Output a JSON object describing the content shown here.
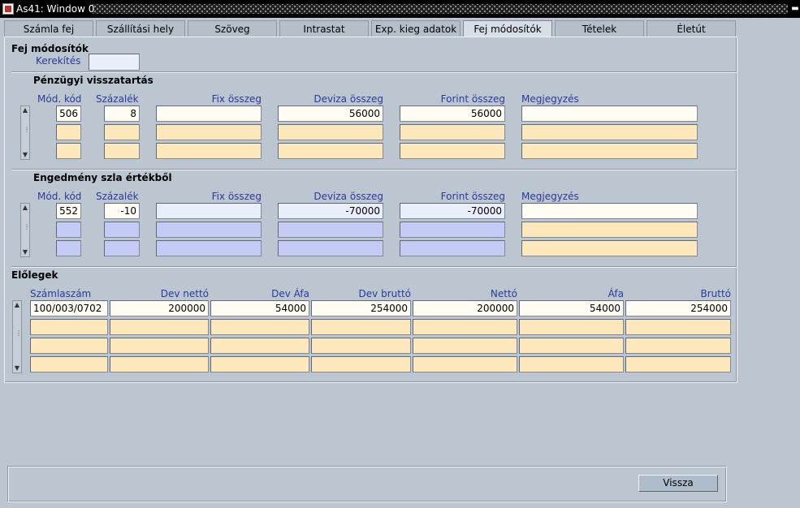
{
  "window": {
    "title": "As41: Window 0"
  },
  "tabs": [
    "Számla fej",
    "Szállítási hely",
    "Szöveg",
    "Intrastat",
    "Exp. kieg adatok",
    "Fej módosítók",
    "Tételek",
    "Életút"
  ],
  "active_tab": "Fej módosítók",
  "fej": {
    "heading": "Fej módosítók",
    "kerekites_label": "Kerekítés",
    "kerekites_value": ""
  },
  "penzugyi": {
    "heading": "Pénzügyi visszatartás",
    "columns": [
      "Mód. kód",
      "Százalék",
      "Fix összeg",
      "Deviza összeg",
      "Forint összeg",
      "Megjegyzés"
    ],
    "rows": [
      [
        "506",
        "8",
        "",
        "56000",
        "56000",
        ""
      ],
      [
        "",
        "",
        "",
        "",
        "",
        ""
      ],
      [
        "",
        "",
        "",
        "",
        "",
        ""
      ]
    ]
  },
  "engedmeny": {
    "heading": "Engedmény szla értékből",
    "columns": [
      "Mód. kód",
      "Százalék",
      "Fix összeg",
      "Deviza összeg",
      "Forint összeg",
      "Megjegyzés"
    ],
    "rows": [
      [
        "552",
        "-10",
        "",
        "-70000",
        "-70000",
        ""
      ],
      [
        "",
        "",
        "",
        "",
        "",
        ""
      ],
      [
        "",
        "",
        "",
        "",
        "",
        ""
      ]
    ]
  },
  "eloleg": {
    "heading": "Előlegek",
    "columns": [
      "Számlaszám",
      "Dev nettó",
      "Dev Áfa",
      "Dev bruttó",
      "Nettó",
      "Áfa",
      "Bruttó"
    ],
    "rows": [
      [
        "100/003/0702",
        "200000",
        "54000",
        "254000",
        "200000",
        "54000",
        "254000"
      ],
      [
        "",
        "",
        "",
        "",
        "",
        "",
        ""
      ],
      [
        "",
        "",
        "",
        "",
        "",
        "",
        ""
      ],
      [
        "",
        "",
        "",
        "",
        "",
        "",
        ""
      ]
    ]
  },
  "footer": {
    "back_label": "Vissza"
  }
}
